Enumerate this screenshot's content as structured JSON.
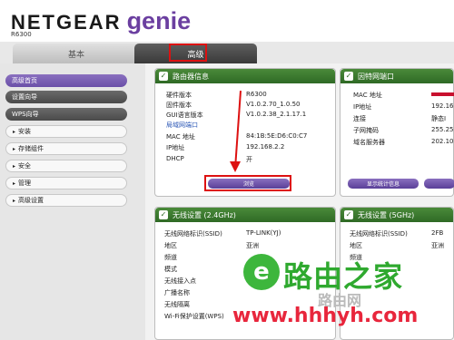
{
  "brand": {
    "name": "NETGEAR",
    "product": "genie",
    "model": "R6300"
  },
  "tabs": {
    "basic": "基本",
    "advanced": "高级"
  },
  "sidebar": {
    "items": [
      {
        "label": "高级首页",
        "style": "active",
        "arrow": ""
      },
      {
        "label": "设置向导",
        "style": "dark",
        "arrow": ""
      },
      {
        "label": "WPS向导",
        "style": "dark",
        "arrow": ""
      },
      {
        "label": "安装",
        "style": "light",
        "arrow": "▸"
      },
      {
        "label": "存储组件",
        "style": "light",
        "arrow": "▸"
      },
      {
        "label": "安全",
        "style": "light",
        "arrow": "▸"
      },
      {
        "label": "管理",
        "style": "light",
        "arrow": "▸"
      },
      {
        "label": "高级设置",
        "style": "light",
        "arrow": "▸"
      }
    ]
  },
  "router_info": {
    "title": "路由器信息",
    "rows": [
      {
        "key": "硬件版本",
        "value": "R6300"
      },
      {
        "key": "固件版本",
        "value": "V1.0.2.70_1.0.50"
      },
      {
        "key": "GUI语言版本",
        "value": "V1.0.2.38_2.1.17.1"
      },
      {
        "key": "局域网端口",
        "value": ""
      },
      {
        "key": "MAC 地址",
        "value": "84:1B:5E:D6:C0:C7"
      },
      {
        "key": "IP地址",
        "value": "192.168.2.2"
      },
      {
        "key": "DHCP",
        "value": "开"
      }
    ],
    "button": "浏览"
  },
  "internet_port": {
    "title": "因特网端口",
    "rows": [
      {
        "key": "MAC 地址",
        "value": ""
      },
      {
        "key": "IP地址",
        "value": "192.16"
      },
      {
        "key": "连接",
        "value": "静态I"
      },
      {
        "key": "子网掩码",
        "value": "255.25"
      },
      {
        "key": "域名服务器",
        "value": "202.10"
      }
    ],
    "button1": "显示统计信息",
    "button2": ""
  },
  "wireless_24": {
    "title": "无线设置 (2.4GHz)",
    "rows": [
      {
        "key": "无线网络标识(SSID)",
        "value": "TP-LINK(YJ)"
      },
      {
        "key": "地区",
        "value": "亚洲"
      },
      {
        "key": "频道",
        "value": ""
      },
      {
        "key": "模式",
        "value": ""
      },
      {
        "key": "无线接入点",
        "value": ""
      },
      {
        "key": "广播名称",
        "value": ""
      },
      {
        "key": "无线隔离",
        "value": ""
      },
      {
        "key": "Wi-Fi保护设置(WPS)",
        "value": ""
      }
    ]
  },
  "wireless_5": {
    "title": "无线设置 (5GHz)",
    "rows": [
      {
        "key": "无线网络标识(SSID)",
        "value": "2FB"
      },
      {
        "key": "地区",
        "value": "亚洲"
      },
      {
        "key": "频道",
        "value": ""
      }
    ]
  },
  "watermark": {
    "symbol": "e",
    "title": "路由之家",
    "url": "www.hhhyh.com",
    "faded": "路由网"
  },
  "colors": {
    "accent_purple": "#6b3fa0",
    "panel_green": "#2f6a25",
    "annotation_red": "#dd1111",
    "watermark_green": "#2fa92f",
    "watermark_red": "#e8263c"
  }
}
